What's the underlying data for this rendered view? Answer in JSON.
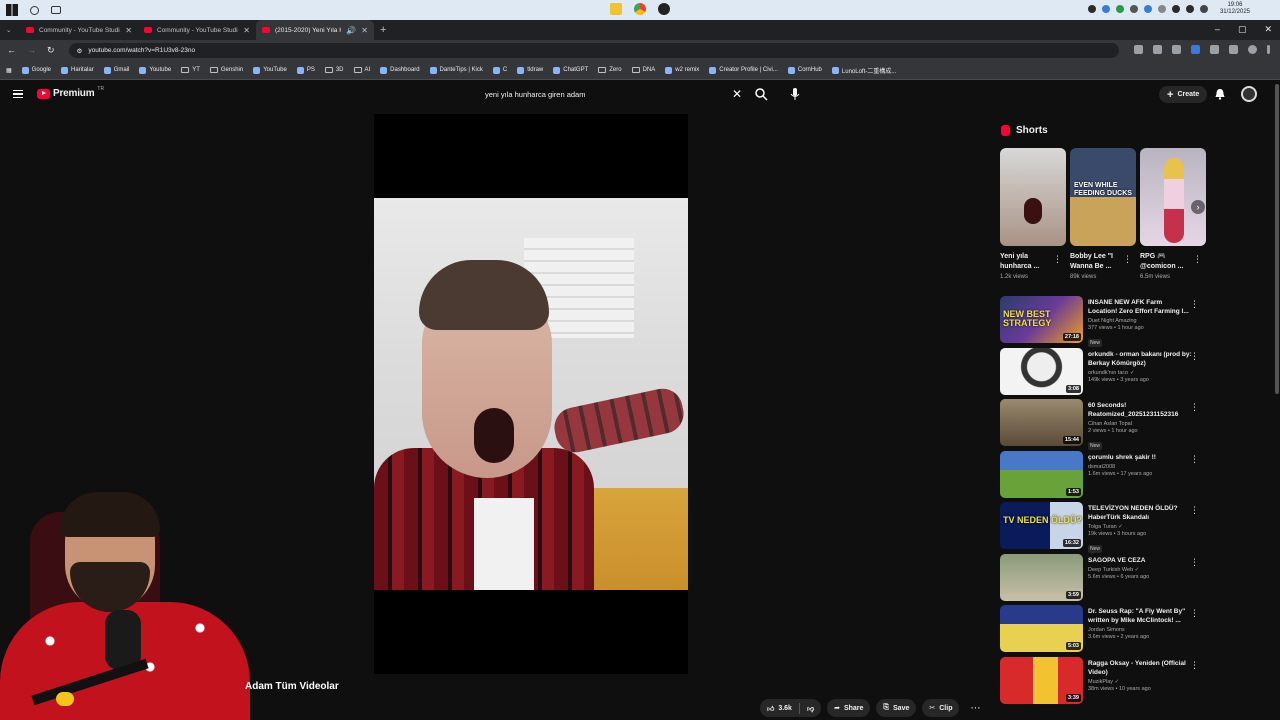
{
  "os": {
    "clock_time": "19:06",
    "clock_date": "31/12/2025"
  },
  "browser": {
    "tabs": [
      {
        "label": "Community - YouTube Studio"
      },
      {
        "label": "Community - YouTube Studio"
      },
      {
        "label": "(2015-2020) Yeni Yıla Hunh..."
      }
    ],
    "url": "youtube.com/watch?v=R1U3v8-23no",
    "bookmarks": [
      "Google",
      "Haritalar",
      "Gmail",
      "Youtube",
      "YT",
      "Genshin",
      "YouTube",
      "PS",
      "3D",
      "AI",
      "Dashboard",
      "DanteTips | Kick",
      "C",
      "tldraw",
      "ChatGPT",
      "Zero",
      "DNA",
      "w2 remix",
      "Creator Profile | Civi...",
      "CornHub",
      "LunoLoft-二重構成..."
    ]
  },
  "youtube": {
    "logo_text": "Premium",
    "logo_country": "TR",
    "search_value": "yeni yıla hunharca giren adam",
    "create_label": "Create"
  },
  "overlay_caption": "Adam Tüm Videolar",
  "actions": {
    "like_count": "3.6k",
    "share_label": "Share",
    "save_label": "Save",
    "clip_label": "Clip"
  },
  "shorts": {
    "heading": "Shorts",
    "items": [
      {
        "title": "Yeni yıla hunharca ...",
        "views": "1.2k views",
        "overlay": ""
      },
      {
        "title": "Bobby Lee \"I Wanna Be ...",
        "views": "89k views",
        "overlay": "EVEN WHILE FEEDING DUCKS"
      },
      {
        "title": "RPG 🎮 @comicon ...",
        "views": "6.5m views",
        "overlay": ""
      }
    ]
  },
  "recommendations": [
    {
      "title": "INSANE NEW AFK Farm Location! Zero Effort Farming I...",
      "channel": "Duet Night Amazing",
      "stats": "377 views • 1 hour ago",
      "badge": "New",
      "duration": "27:18",
      "thumb_text": "NEW BEST STRATEGY"
    },
    {
      "title": "orkundk - orman bakanı (prod by: Berkay Kömürgöz)",
      "channel": "orkundk'nın tarzı ✓",
      "stats": "149k views • 3 years ago",
      "badge": "",
      "duration": "3:08",
      "thumb_text": ""
    },
    {
      "title": "60 Seconds! Reatomized_20251231152316",
      "channel": "Cihan Aslan Topal",
      "stats": "2 views • 1 hour ago",
      "badge": "New",
      "duration": "15:44",
      "thumb_text": ""
    },
    {
      "title": "çorumlu shrek şakir !!",
      "channel": "dsmat2008",
      "stats": "1.6m views • 17 years ago",
      "badge": "",
      "duration": "1:53",
      "thumb_text": ""
    },
    {
      "title": "TELEVİZYON NEDEN ÖLDÜ? HaberTürk Skandalı",
      "channel": "Tolga Turan ✓",
      "stats": "19k views • 3 hours ago",
      "badge": "New",
      "duration": "16:32",
      "thumb_text": "TV NEDEN ÖLDÜ?"
    },
    {
      "title": "SAGOPA VE CEZA",
      "channel": "Deep Turkish Web ✓",
      "stats": "5.6m views • 6 years ago",
      "badge": "",
      "duration": "3:59",
      "thumb_text": ""
    },
    {
      "title": "Dr. Seuss Rap: \"A Fly Went By\" written by Mike McClintock! ...",
      "channel": "Jordan Simons",
      "stats": "3.6m views • 2 years ago",
      "badge": "",
      "duration": "5:03",
      "thumb_text": ""
    },
    {
      "title": "Ragga Oksay - Yeniden (Official Video)",
      "channel": "MuzikPlay ✓",
      "stats": "38m views • 10 years ago",
      "badge": "",
      "duration": "3:39",
      "thumb_text": ""
    }
  ]
}
